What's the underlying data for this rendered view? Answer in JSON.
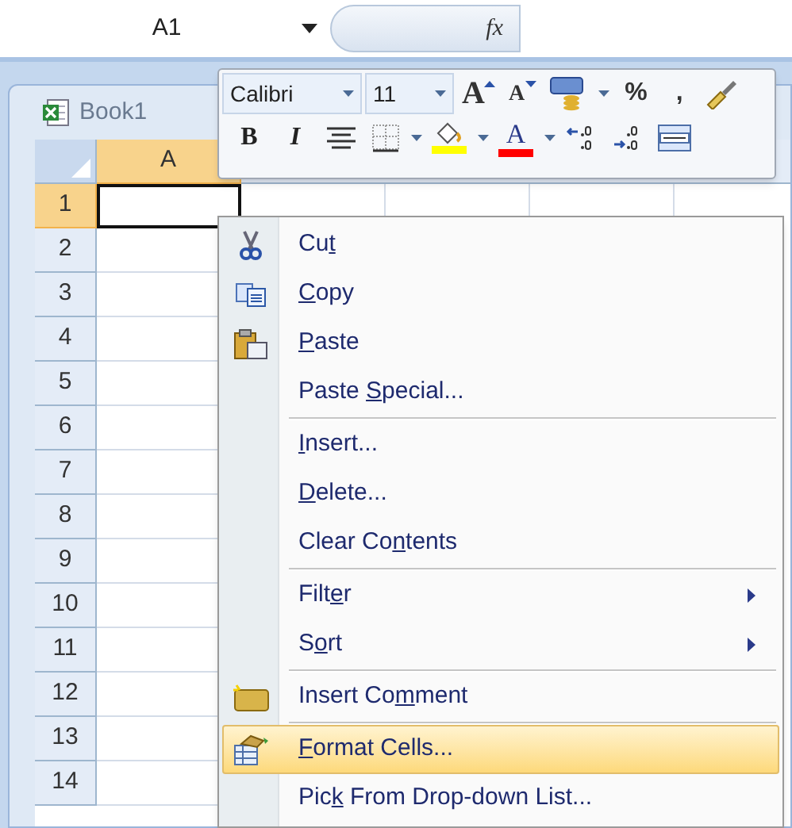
{
  "name_box": "A1",
  "formula_label": "fx",
  "workbook_tab": {
    "label": "Book1"
  },
  "columns": [
    {
      "label": "A",
      "selected": true
    }
  ],
  "rows": [
    {
      "label": "1",
      "selected": true
    },
    {
      "label": "2",
      "selected": false
    },
    {
      "label": "3",
      "selected": false
    },
    {
      "label": "4",
      "selected": false
    },
    {
      "label": "5",
      "selected": false
    },
    {
      "label": "6",
      "selected": false
    },
    {
      "label": "7",
      "selected": false
    },
    {
      "label": "8",
      "selected": false
    },
    {
      "label": "9",
      "selected": false
    },
    {
      "label": "10",
      "selected": false
    },
    {
      "label": "11",
      "selected": false
    },
    {
      "label": "12",
      "selected": false
    },
    {
      "label": "13",
      "selected": false
    },
    {
      "label": "14",
      "selected": false
    }
  ],
  "mini_toolbar": {
    "font": "Calibri",
    "size": "11",
    "row_1": [
      {
        "kind": "grow",
        "text": "A"
      },
      {
        "kind": "shrink",
        "text": "A"
      },
      {
        "kind": "accounting"
      },
      {
        "kind": "char",
        "text": "%"
      },
      {
        "kind": "char",
        "text": ","
      },
      {
        "kind": "painter"
      }
    ],
    "row_2": [
      {
        "kind": "bold",
        "text": "B"
      },
      {
        "kind": "italic",
        "text": "I"
      },
      {
        "kind": "center"
      },
      {
        "kind": "borders"
      },
      {
        "kind": "fill",
        "color": "#ffff00"
      },
      {
        "kind": "fontcolor",
        "text": "A",
        "color": "#ff0000"
      },
      {
        "kind": "incdec"
      },
      {
        "kind": "decdec"
      },
      {
        "kind": "merge"
      }
    ]
  },
  "context_menu": [
    {
      "kind": "cut",
      "label": {
        "before": "Cu",
        "key": "t"
      },
      "submenu": false,
      "selected": false
    },
    {
      "kind": "copy",
      "label": {
        "key": "C",
        "after": "opy"
      },
      "submenu": false,
      "selected": false
    },
    {
      "kind": "paste",
      "label": {
        "key": "P",
        "after": "aste"
      },
      "submenu": false,
      "selected": false
    },
    {
      "kind": "plain",
      "label": {
        "before": "Paste ",
        "key": "S",
        "after": "pecial..."
      },
      "submenu": false,
      "selected": false
    },
    {
      "kind": "separator"
    },
    {
      "kind": "plain",
      "label": {
        "key": "I",
        "after": "nsert..."
      },
      "submenu": false,
      "selected": false
    },
    {
      "kind": "plain",
      "label": {
        "key": "D",
        "after": "elete..."
      },
      "submenu": false,
      "selected": false
    },
    {
      "kind": "plain",
      "label": {
        "before": "Clear Co",
        "key": "n",
        "after": "tents"
      },
      "submenu": false,
      "selected": false
    },
    {
      "kind": "separator"
    },
    {
      "kind": "plain",
      "label": {
        "before": "Filt",
        "key": "e",
        "after": "r"
      },
      "submenu": true,
      "selected": false
    },
    {
      "kind": "plain",
      "label": {
        "before": "S",
        "key": "o",
        "after": "rt"
      },
      "submenu": true,
      "selected": false
    },
    {
      "kind": "separator"
    },
    {
      "kind": "comment",
      "label": {
        "before": "Insert Co",
        "key": "m",
        "after": "ment"
      },
      "submenu": false,
      "selected": false
    },
    {
      "kind": "separator"
    },
    {
      "kind": "format",
      "label": {
        "key": "F",
        "after": "ormat Cells..."
      },
      "submenu": false,
      "selected": true
    },
    {
      "kind": "plain",
      "label": {
        "before": "Pic",
        "key": "k",
        "after": " From Drop-down List..."
      },
      "submenu": false,
      "selected": false
    }
  ]
}
